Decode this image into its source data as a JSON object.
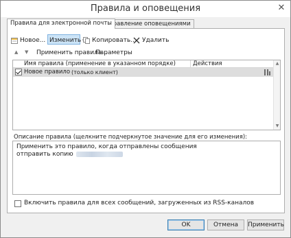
{
  "window": {
    "title": "Правила и оповещения",
    "close_glyph": "✕"
  },
  "tabs": [
    {
      "label": "Правила для электронной почты",
      "active": true
    },
    {
      "label": "Управление оповещениями",
      "active": false
    }
  ],
  "toolbar": {
    "new_label": "Новое...",
    "change_label": "Изменить",
    "copy_label": "Копировать...",
    "delete_label": "Удалить"
  },
  "toolbar2": {
    "apply_label": "Применить правила...",
    "options_label": "Параметры"
  },
  "rules_table": {
    "columns": [
      "Имя правила (применение в указанном порядке)",
      "Действия"
    ],
    "rows": [
      {
        "name": "Новое правило",
        "note": "(только клиент)",
        "checked": true
      }
    ]
  },
  "description": {
    "label": "Описание правила (щелкните подчеркнутое значение для его изменения):",
    "line1": "Применить это правило, когда отправлены сообщения",
    "line2": "отправить копию"
  },
  "rss_option": {
    "label": "Включить правила для всех сообщений, загруженных из RSS-каналов",
    "checked": false
  },
  "buttons": {
    "ok": "OK",
    "cancel": "Отмена",
    "apply": "Применить"
  },
  "colors": {
    "selection": "#cce4f7",
    "accent": "#3c7fb1",
    "row_highlight": "#dddddd"
  }
}
